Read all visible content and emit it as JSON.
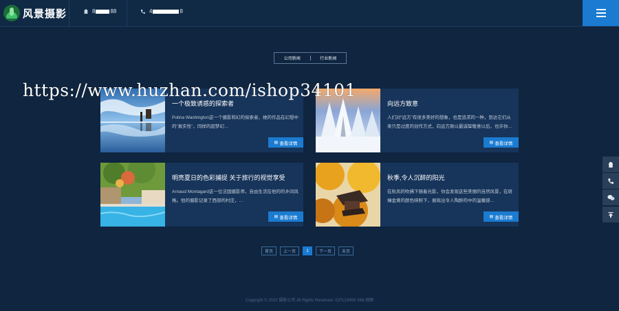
{
  "header": {
    "logo_text": "风景摄影",
    "contact_1": {
      "icon": "qq-icon",
      "prefix": "8",
      "suffix": "88"
    },
    "contact_2": {
      "icon": "phone-icon",
      "prefix": "4",
      "suffix": "8"
    },
    "menu_icon": "hamburger-icon"
  },
  "tabs": [
    {
      "label": "公司新闻"
    },
    {
      "label": "行业新闻"
    }
  ],
  "articles": [
    {
      "title": "一个极致诱惑的探索者",
      "desc": "Polina Washington这一个摄影和幻的探索者，她的作品在幻想中的“真实性”，同样的超梦幻…",
      "button": "查看详情",
      "image": "sky-reflection"
    },
    {
      "title": "向远方致意",
      "desc": "人们对“远方”有很多美好的想象，也是追求的一种，到达它们从来只是过度的创作方式，向远方致以最诚挚敬意以后，也许你…",
      "button": "查看详情",
      "image": "snow-forest"
    },
    {
      "title": "明亮夏日的色彩捕捉 关于旅行的视觉享受",
      "desc": "Arnaud Montagard这一位法国摄影师，自由生活在他的的乡间风格。他的摄影记录了西部的村庄，…",
      "button": "查看详情",
      "image": "summer-pool"
    },
    {
      "title": "秋季,令人沉醉的阳光",
      "desc": "在秋风的吹拂下随着光影，你会发现这些美丽的自然风景，在斑斓金黄的颜色映照下，展现出令人陶醉的中的温暖感…",
      "button": "查看详情",
      "image": "autumn-pagoda"
    }
  ],
  "pagination": {
    "first": "首页",
    "prev": "上一页",
    "current": "1",
    "next": "下一页",
    "last": "末页"
  },
  "footer": {
    "text": "Copyright © 2022 摄影公司 All Rights Reserved. ICP123456 XML地图"
  },
  "watermark": "https://www.huzhan.com/ishop34101",
  "side_tools": [
    {
      "icon": "qq-icon"
    },
    {
      "icon": "phone-icon"
    },
    {
      "icon": "wechat-icon"
    },
    {
      "icon": "back-to-top-icon"
    }
  ],
  "colors": {
    "background": "#0f2540",
    "card": "#17345a",
    "accent": "#1a7bd1"
  }
}
